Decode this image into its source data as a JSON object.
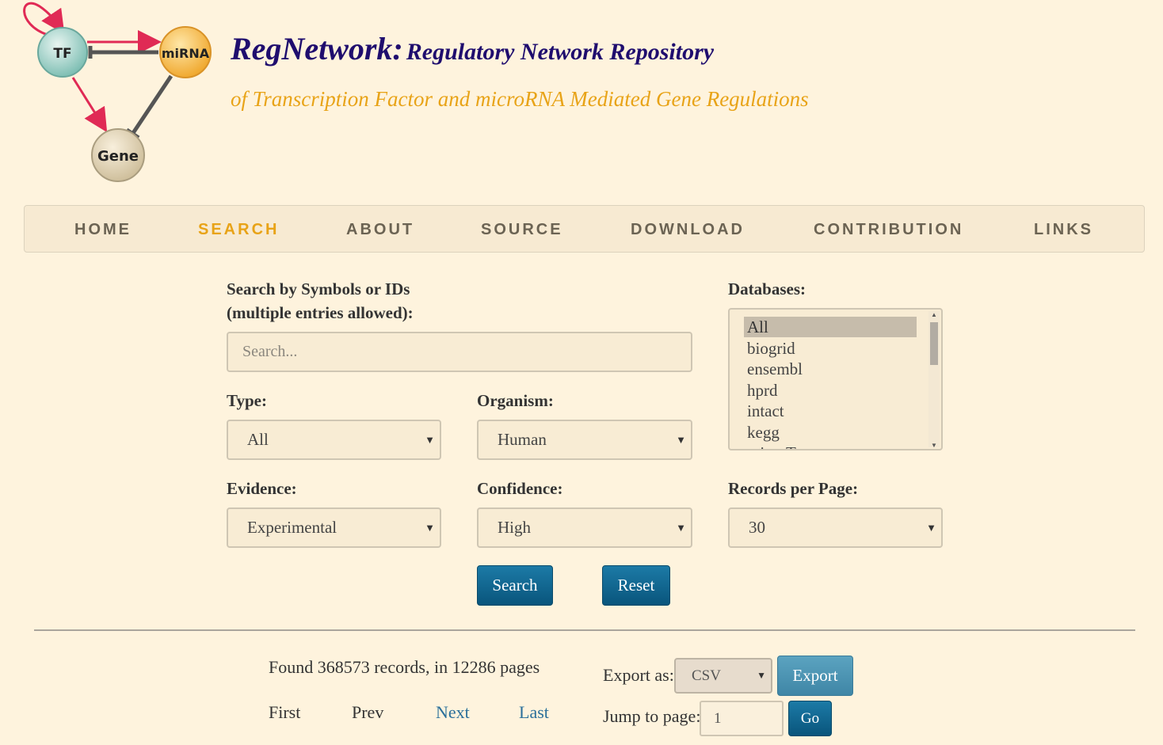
{
  "header": {
    "logo": {
      "tf": "TF",
      "mirna": "miRNA",
      "gene": "Gene"
    },
    "title_main": "RegNetwork:",
    "title_rest": "Regulatory Network Repository",
    "subtitle": "of Transcription Factor and microRNA Mediated Gene Regulations"
  },
  "nav": {
    "items": [
      "HOME",
      "SEARCH",
      "ABOUT",
      "SOURCE",
      "DOWNLOAD",
      "CONTRIBUTION",
      "LINKS"
    ],
    "active": "SEARCH"
  },
  "form": {
    "search_label_1": "Search by Symbols or IDs",
    "search_label_2": "(multiple entries allowed):",
    "search_placeholder": "Search...",
    "search_value": "",
    "type_label": "Type:",
    "type_value": "All",
    "organism_label": "Organism:",
    "organism_value": "Human",
    "evidence_label": "Evidence:",
    "evidence_value": "Experimental",
    "confidence_label": "Confidence:",
    "confidence_value": "High",
    "records_label": "Records per Page:",
    "records_value": "30",
    "databases_label": "Databases:",
    "databases": [
      "All",
      "biogrid",
      "ensembl",
      "hprd",
      "intact",
      "kegg",
      "miranTar"
    ],
    "databases_selected": "All",
    "search_button": "Search",
    "reset_button": "Reset"
  },
  "results": {
    "found_text": "Found 368573 records, in 12286 pages",
    "first": "First",
    "prev": "Prev",
    "next": "Next",
    "last": "Last",
    "export_label": "Export as:",
    "export_format": "CSV",
    "export_button": "Export",
    "jump_label": "Jump to page:",
    "jump_value": "1",
    "go_button": "Go"
  },
  "colors": {
    "background": "#fef3dd",
    "title": "#1f0d6e",
    "accent": "#e8a317",
    "button": "#0d5f88",
    "link": "#2a6f9a"
  }
}
